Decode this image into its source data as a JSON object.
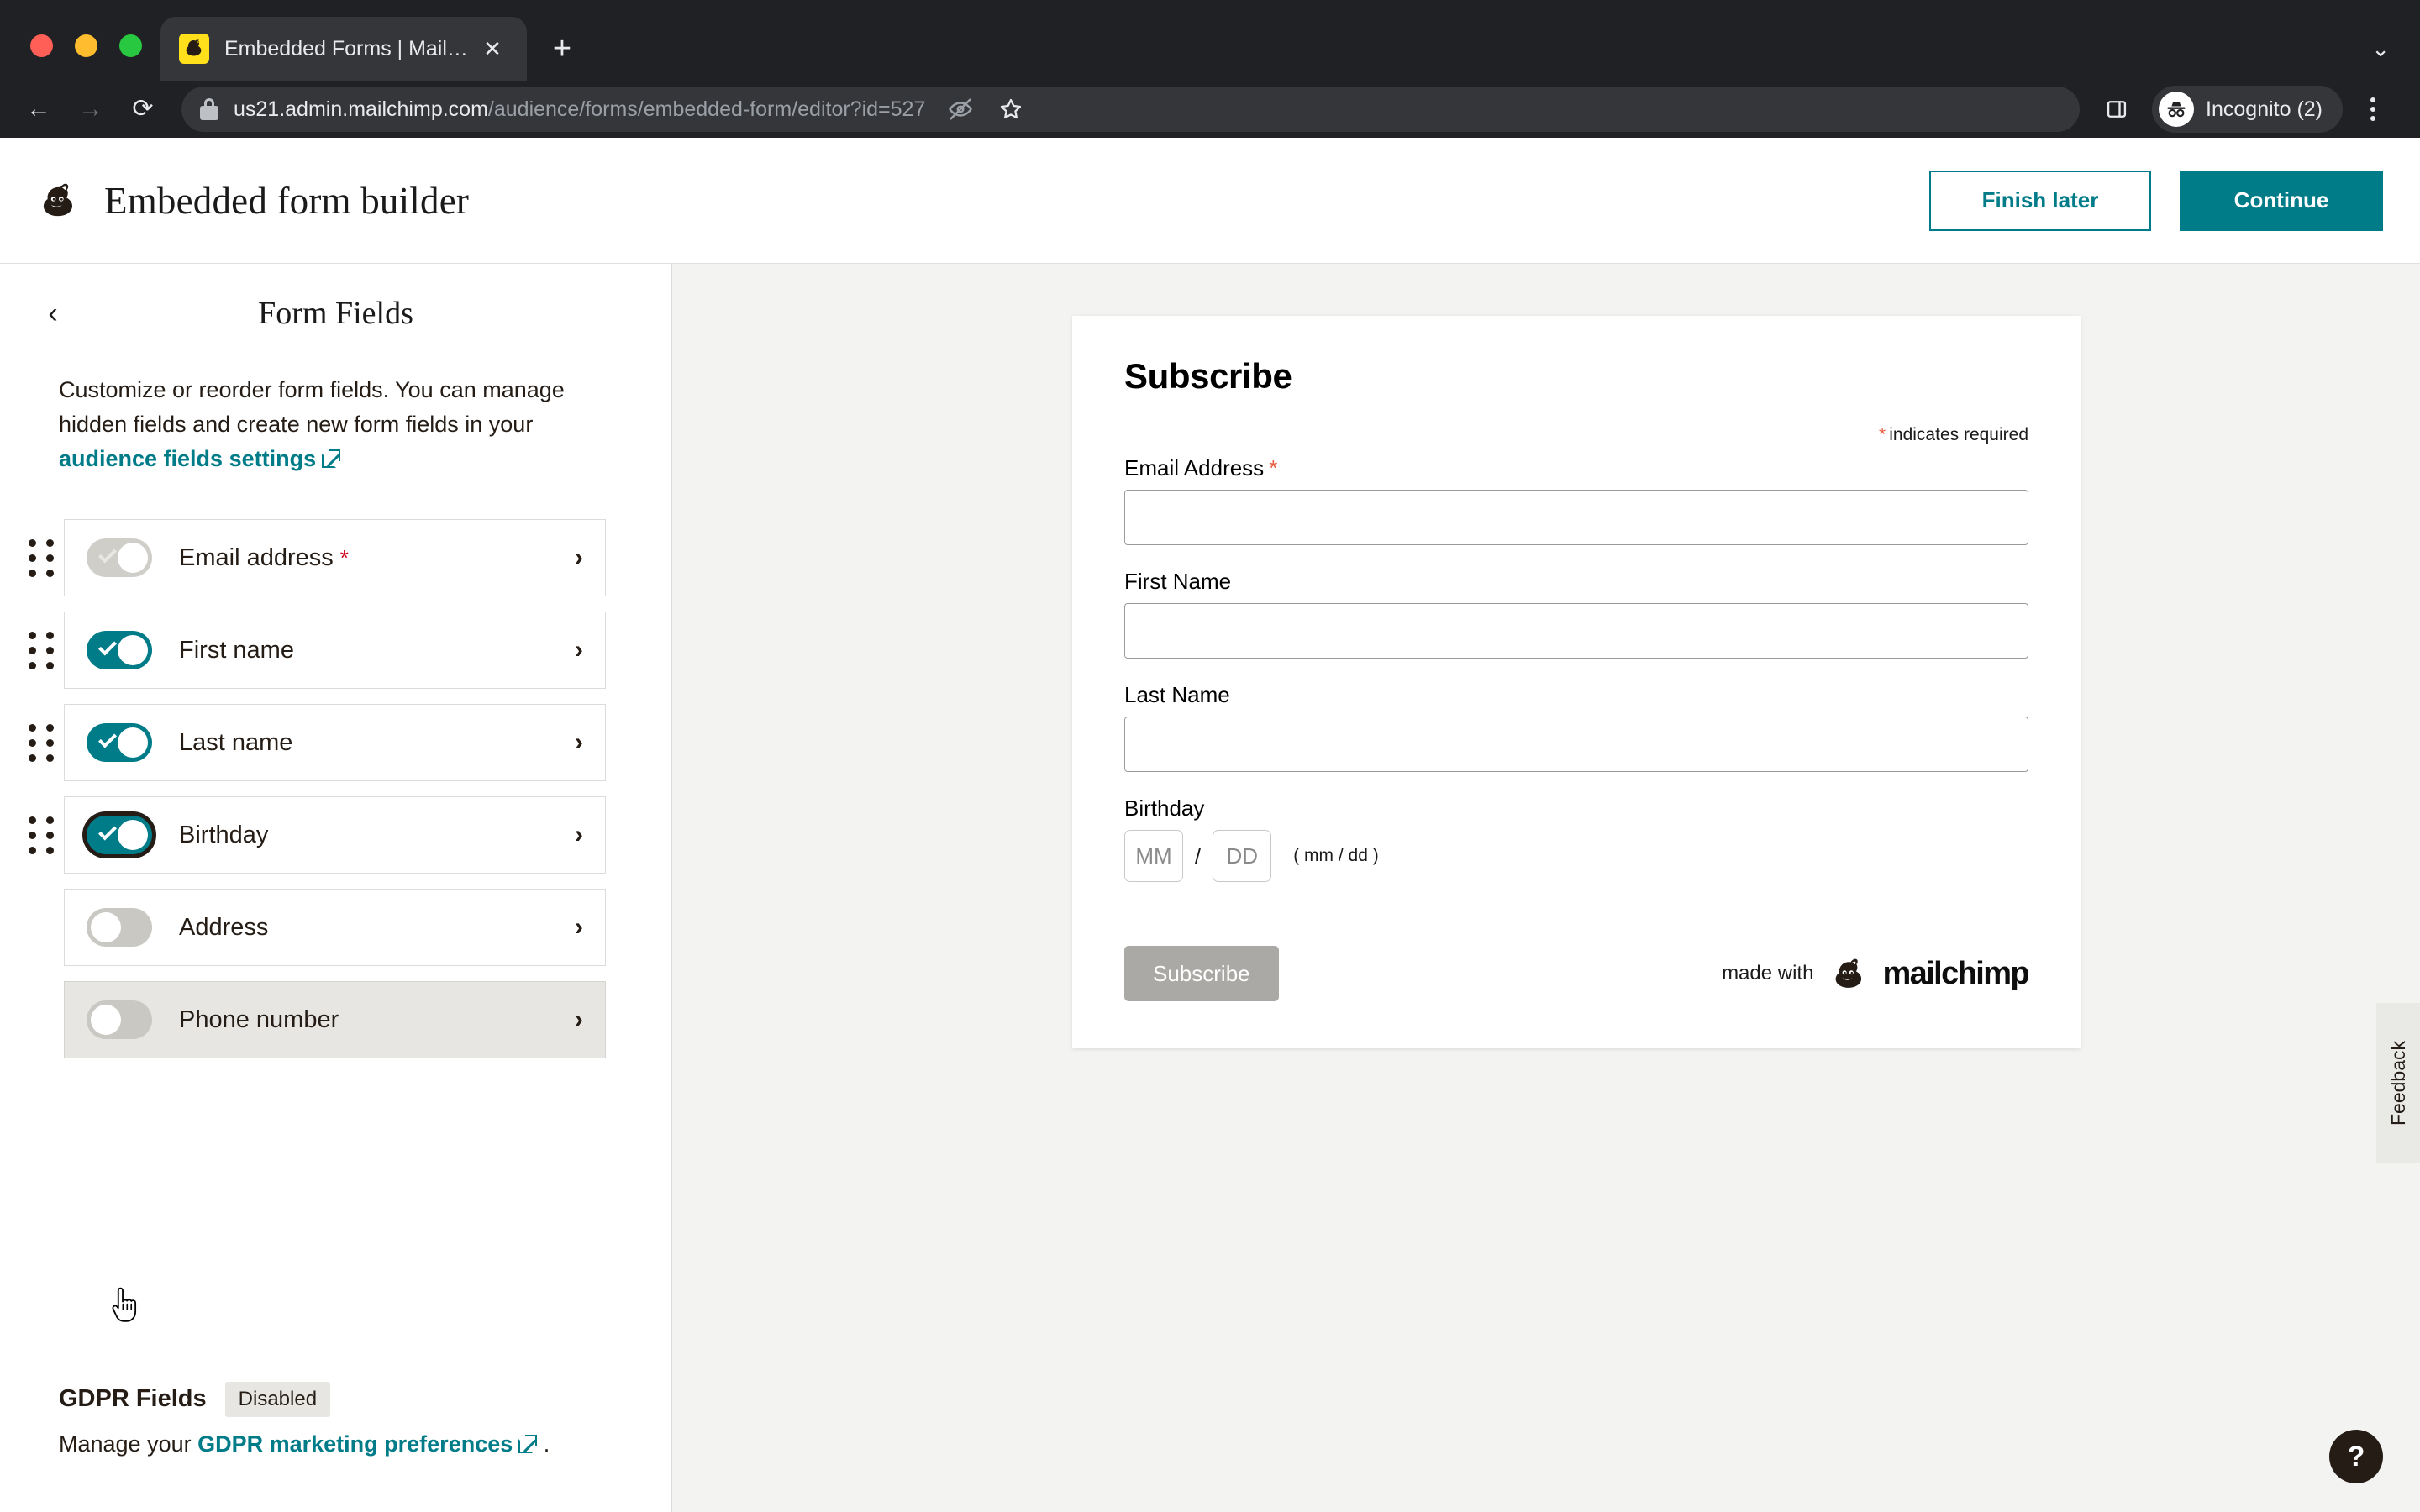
{
  "browser": {
    "tab": {
      "title": "Embedded Forms | Mailchimp",
      "favicon": "mailchimp-favicon",
      "close_label": "✕"
    },
    "new_tab_label": "+",
    "tab_list_caret": "⌄",
    "nav": {
      "back": "←",
      "forward": "→",
      "reload": "⟳"
    },
    "url": {
      "host": "us21.admin.mailchimp.com",
      "path": "/audience/forms/embedded-form/editor?id=527"
    },
    "omni_icons": [
      "eye-off-icon",
      "star-icon"
    ],
    "toolbar_icons": [
      "side-panel-icon"
    ],
    "profile": {
      "name": "Incognito (2)",
      "avatar": "incognito-icon"
    },
    "menu_label": "⋮"
  },
  "header": {
    "logo": "mailchimp-logo",
    "title": "Embedded form builder",
    "finish_later_label": "Finish later",
    "continue_label": "Continue"
  },
  "sidebar": {
    "back_label": "‹",
    "panel_title": "Form Fields",
    "description_pre": "Customize or reorder form fields. You can manage hidden fields and create new form fields in your ",
    "description_link": "audience fields settings",
    "fields": [
      {
        "label": "Email address",
        "toggle": "on",
        "locked": true,
        "required": true,
        "draggable": true,
        "hovered": false,
        "focused": false
      },
      {
        "label": "First name",
        "toggle": "on",
        "locked": false,
        "required": false,
        "draggable": true,
        "hovered": false,
        "focused": false
      },
      {
        "label": "Last name",
        "toggle": "on",
        "locked": false,
        "required": false,
        "draggable": true,
        "hovered": false,
        "focused": false
      },
      {
        "label": "Birthday",
        "toggle": "on",
        "locked": false,
        "required": false,
        "draggable": true,
        "hovered": false,
        "focused": true
      },
      {
        "label": "Address",
        "toggle": "off",
        "locked": false,
        "required": false,
        "draggable": false,
        "hovered": false,
        "focused": false
      },
      {
        "label": "Phone number",
        "toggle": "off",
        "locked": false,
        "required": false,
        "draggable": false,
        "hovered": true,
        "focused": false
      }
    ],
    "row_chevron": "›",
    "gdpr": {
      "title": "GDPR Fields",
      "badge": "Disabled",
      "text_pre": "Manage your ",
      "link": "GDPR marketing preferences",
      "text_post": "."
    }
  },
  "preview": {
    "title": "Subscribe",
    "indicates_star": "*",
    "indicates_text": "indicates required",
    "fields": [
      {
        "label": "Email Address",
        "required": true,
        "value": "",
        "placeholder": ""
      },
      {
        "label": "First Name",
        "required": false,
        "value": "",
        "placeholder": ""
      },
      {
        "label": "Last Name",
        "required": false,
        "value": "",
        "placeholder": ""
      }
    ],
    "birthday": {
      "label": "Birthday",
      "month_placeholder": "MM",
      "separator": "/",
      "day_placeholder": "DD",
      "hint": "( mm / dd )"
    },
    "submit_label": "Subscribe",
    "made_with_text": "made with",
    "brand_wordmark": "mailchimp"
  },
  "overlays": {
    "feedback_label": "Feedback",
    "help_label": "?"
  },
  "colors": {
    "teal": "#007c89",
    "required_red": "#d0021b",
    "preview_star": "#e85c41",
    "chrome_bg": "#202124",
    "canvas_bg": "#f3f3f1"
  }
}
